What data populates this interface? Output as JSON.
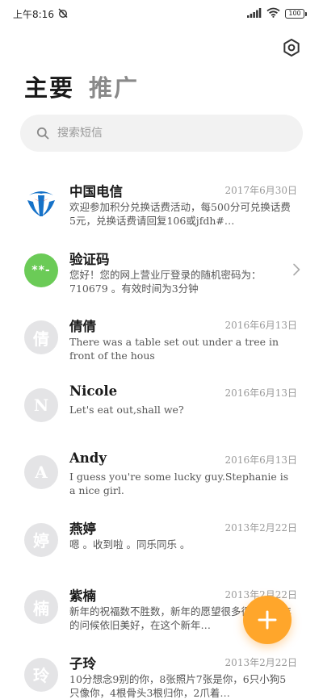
{
  "status_bar": {
    "time": "上午8:16",
    "battery": "100"
  },
  "tabs": [
    {
      "label": "主要",
      "active": true
    },
    {
      "label": "推广",
      "active": false
    }
  ],
  "search": {
    "placeholder": "搜索短信"
  },
  "conversations": [
    {
      "avatar": "logo",
      "name": "中国电信",
      "date": "2017年6月30日",
      "preview": "欢迎参加积分兑换话费活动，每500分可兑换话费5元，兑换话费请回复106或jfdh#…"
    },
    {
      "avatar": "**-",
      "name": "验证码",
      "date": "",
      "preview": "您好！您的网上营业厅登录的随机密码为：710679 。有效时间为3分钟"
    },
    {
      "avatar": "倩",
      "name": "倩倩",
      "date": "2016年6月13日",
      "preview": "There was a table set out under a tree in front of the hous"
    },
    {
      "avatar": "N",
      "name": "Nicole",
      "date": "2016年6月13日",
      "preview": "Let's eat out,shall we?"
    },
    {
      "avatar": "A",
      "name": "Andy",
      "date": "2016年6月13日",
      "preview": "I guess you're some lucky guy.Stephanie is a nice girl."
    },
    {
      "avatar": "婷",
      "name": "燕婷",
      "date": "2013年2月22日",
      "preview": "嗯 。收到啦 。同乐同乐 。"
    },
    {
      "avatar": "楠",
      "name": "紫楠",
      "date": "2013年2月22日",
      "preview": "新年的祝福数不胜数，新年的愿望很多很多，新年的问候依旧美好，在这个新年…"
    },
    {
      "avatar": "玲",
      "name": "子玲",
      "date": "2013年2月22日",
      "preview": "10分想念9别的你，8张照片7张是你，6只小狗5只像你，4根骨头3根归你，2爪着…"
    }
  ],
  "colors": {
    "accent": "#ffa62b",
    "verify_avatar": "#6bcb57",
    "avatar_gray": "#e4e4e6"
  }
}
